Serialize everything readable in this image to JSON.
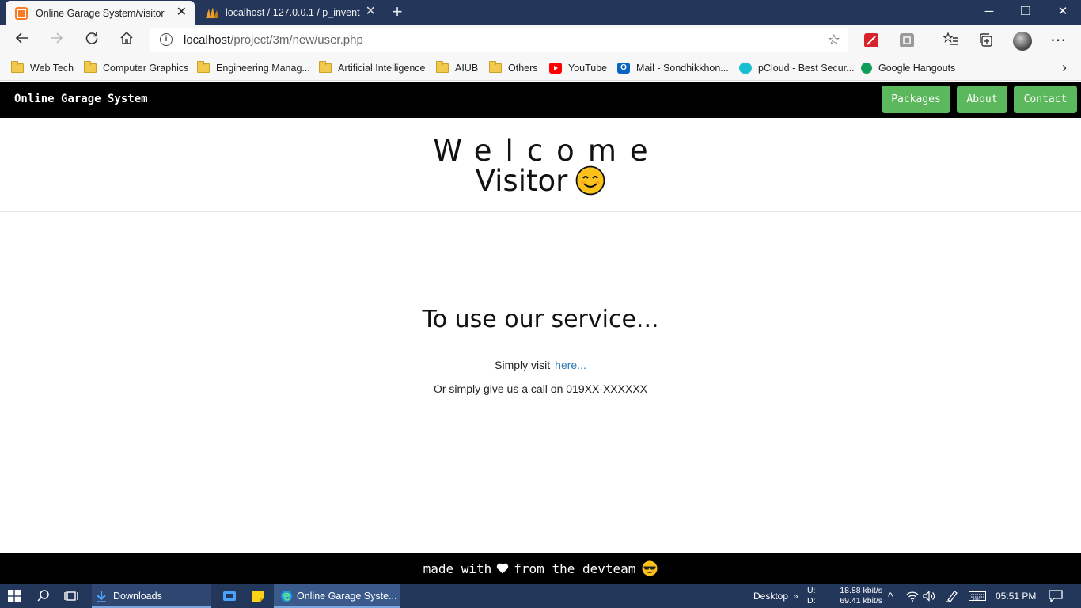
{
  "browser": {
    "tabs": [
      {
        "title": "Online Garage System/visitor",
        "active": true,
        "favicon_color": "#fb7a24"
      },
      {
        "title": "localhost / 127.0.0.1 / p_inventory",
        "active": false,
        "favicon_color": "#f0a030"
      }
    ],
    "address_bar": {
      "host": "localhost",
      "path": "/project/3m/new/user.php"
    },
    "bookmarks": [
      {
        "label": "Web Tech",
        "icon": "folder-icon"
      },
      {
        "label": "Computer Graphics",
        "icon": "folder-icon"
      },
      {
        "label": "Engineering Manag...",
        "icon": "folder-icon"
      },
      {
        "label": "Artificial Intelligence",
        "icon": "folder-icon"
      },
      {
        "label": "AIUB",
        "icon": "folder-icon"
      },
      {
        "label": "Others",
        "icon": "folder-icon"
      },
      {
        "label": "YouTube",
        "icon": "youtube-icon"
      },
      {
        "label": "Mail - Sondhikkhon...",
        "icon": "outlook-icon"
      },
      {
        "label": "pCloud - Best Secur...",
        "icon": "pcloud-icon"
      },
      {
        "label": "Google Hangouts",
        "icon": "hangouts-icon"
      }
    ]
  },
  "site": {
    "brand": "Online Garage System",
    "nav": [
      "Packages",
      "About",
      "Contact"
    ],
    "accent_color": "#5cb85c",
    "welcome_line1": "Welcome",
    "welcome_line2": "Visitor",
    "service_title": "To use our service...",
    "visit_text": "Simply visit",
    "visit_link": "here...",
    "call_text": "Or simply give us a call on 019XX-XXXXXX",
    "footer": {
      "prefix": "made with",
      "suffix": "from the devteam"
    }
  },
  "taskbar": {
    "downloads_label": "Downloads",
    "edge_label": "Online Garage Syste...",
    "desktop_label": "Desktop",
    "upload_label": "U:",
    "download_label": "D:",
    "upload_speed": "18.88 kbit/s",
    "download_speed": "69.41 kbit/s",
    "time": "05:51 PM"
  }
}
